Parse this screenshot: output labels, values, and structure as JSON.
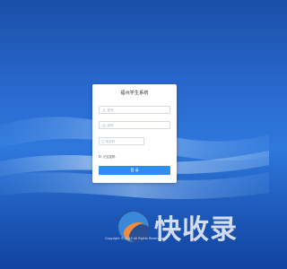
{
  "login": {
    "title": "福州学生系统",
    "username_placeholder": "账号",
    "password_placeholder": "密码",
    "captcha_placeholder": "验证码",
    "remember_label": "记住密码",
    "submit_label": "登 录"
  },
  "watermark": {
    "text": "快收录"
  },
  "footer": {
    "copyright": "Copyright © 2022 All Rights Reserved."
  },
  "colors": {
    "primary": "#2f8cf0",
    "background": "#2a6ad0"
  },
  "icons": {
    "username": "user-icon",
    "password": "lock-icon",
    "captcha": "shield-icon"
  }
}
